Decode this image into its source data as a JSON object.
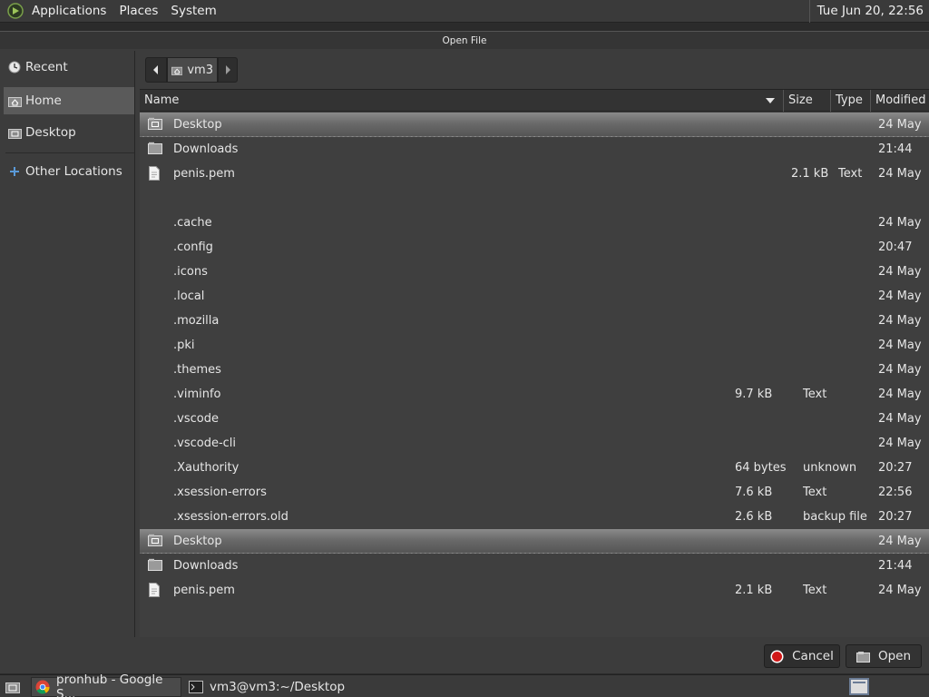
{
  "top_panel": {
    "menus": [
      "Applications",
      "Places",
      "System"
    ],
    "clock": "Tue Jun 20, 22:56"
  },
  "dialog": {
    "title": "Open File",
    "sidebar": [
      {
        "label": "Recent",
        "icon": "recent-icon"
      },
      {
        "label": "Home",
        "icon": "home-icon",
        "selected": true
      },
      {
        "label": "Desktop",
        "icon": "desktop-folder-icon"
      },
      {
        "label": "Other Locations",
        "icon": "plus-icon"
      }
    ],
    "pathbar": {
      "current": "vm3"
    },
    "columns": {
      "name": "Name",
      "size": "Size",
      "type": "Type",
      "modified": "Modified"
    },
    "files": [
      {
        "name": "Desktop",
        "size": "",
        "type": "",
        "modified": "24 May",
        "icon": "desktop-folder-icon",
        "highlight": true
      },
      {
        "name": "Downloads",
        "size": "",
        "type": "",
        "modified": "21:44",
        "icon": "folder-icon"
      },
      {
        "name": "penis.pem",
        "size": "2.1 kB",
        "type": "Text",
        "modified": "24 May",
        "icon": "file-icon"
      },
      {
        "name": "",
        "size": "",
        "type": "",
        "modified": "",
        "icon": ""
      },
      {
        "name": ".cache",
        "size": "",
        "type": "",
        "modified": "24 May",
        "icon": ""
      },
      {
        "name": ".config",
        "size": "",
        "type": "",
        "modified": "20:47",
        "icon": ""
      },
      {
        "name": ".icons",
        "size": "",
        "type": "",
        "modified": "24 May",
        "icon": ""
      },
      {
        "name": ".local",
        "size": "",
        "type": "",
        "modified": "24 May",
        "icon": ""
      },
      {
        "name": ".mozilla",
        "size": "",
        "type": "",
        "modified": "24 May",
        "icon": ""
      },
      {
        "name": ".pki",
        "size": "",
        "type": "",
        "modified": "24 May",
        "icon": ""
      },
      {
        "name": ".themes",
        "size": "",
        "type": "",
        "modified": "24 May",
        "icon": ""
      },
      {
        "name": ".viminfo",
        "size": "9.7 kB",
        "type": "Text",
        "modified": "24 May",
        "icon": ""
      },
      {
        "name": ".vscode",
        "size": "",
        "type": "",
        "modified": "24 May",
        "icon": ""
      },
      {
        "name": ".vscode-cli",
        "size": "",
        "type": "",
        "modified": "24 May",
        "icon": ""
      },
      {
        "name": ".Xauthority",
        "size": "64 bytes",
        "type": "unknown",
        "modified": "20:27",
        "icon": ""
      },
      {
        "name": ".xsession-errors",
        "size": "7.6 kB",
        "type": "Text",
        "modified": "22:56",
        "icon": ""
      },
      {
        "name": ".xsession-errors.old",
        "size": "2.6 kB",
        "type": "backup file",
        "modified": "20:27",
        "icon": ""
      },
      {
        "name": "Desktop",
        "size": "",
        "type": "",
        "modified": "24 May",
        "icon": "desktop-folder-icon",
        "highlight": true
      },
      {
        "name": "Downloads",
        "size": "",
        "type": "",
        "modified": "21:44",
        "icon": "folder-icon"
      },
      {
        "name": "penis.pem",
        "size": "2.1 kB",
        "type": "Text",
        "modified": "24 May",
        "icon": "file-icon"
      }
    ],
    "buttons": {
      "cancel": "Cancel",
      "open": "Open"
    }
  },
  "taskbar": {
    "items": [
      {
        "label": "pronhub - Google S...",
        "icon": "chrome-icon"
      },
      {
        "label": "vm3@vm3:~/Desktop",
        "icon": "terminal-icon"
      }
    ]
  },
  "colors": {
    "highlight": "#7a7a7a",
    "cancel_icon": "#d01818",
    "background": "#3c3c3c"
  }
}
